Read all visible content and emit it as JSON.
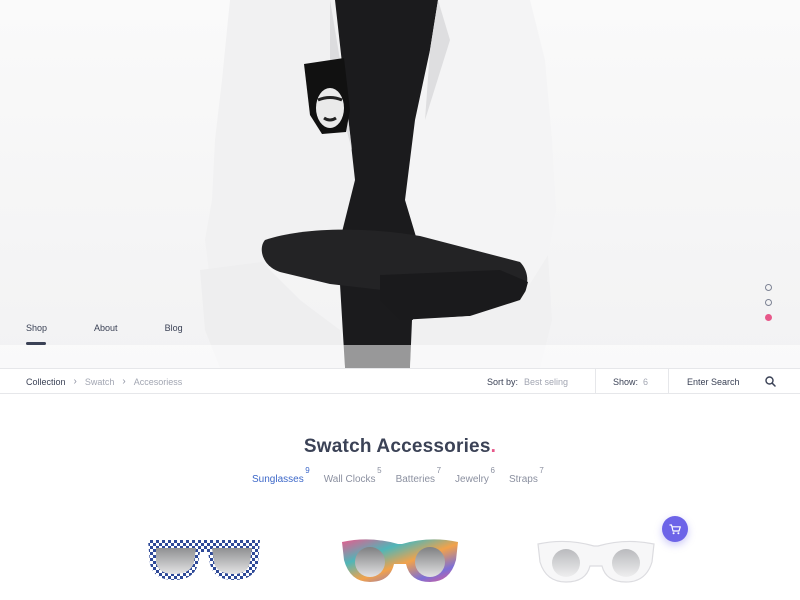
{
  "nav": {
    "items": [
      {
        "label": "Shop",
        "active": true
      },
      {
        "label": "About",
        "active": false
      },
      {
        "label": "Blog",
        "active": false
      }
    ]
  },
  "slider": {
    "slides": 3,
    "active_index": 2
  },
  "toolbar": {
    "breadcrumb": [
      "Collection",
      "Swatch",
      "Accesoriess"
    ],
    "sort_label": "Sort by:",
    "sort_value": "Best seling",
    "show_label": "Show:",
    "show_value": "6",
    "search_placeholder": "Enter Search"
  },
  "section": {
    "title": "Swatch Accessories",
    "title_accent": "."
  },
  "categories": [
    {
      "label": "Sunglasses",
      "count": "9",
      "active": true
    },
    {
      "label": "Wall Clocks",
      "count": "5",
      "active": false
    },
    {
      "label": "Batteries",
      "count": "7",
      "active": false
    },
    {
      "label": "Jewelry",
      "count": "6",
      "active": false
    },
    {
      "label": "Straps",
      "count": "7",
      "active": false
    }
  ],
  "products": [
    {
      "name": "checkered-blue-sunglasses"
    },
    {
      "name": "rainbow-round-sunglasses"
    },
    {
      "name": "clear-white-sunglasses"
    }
  ],
  "colors": {
    "accent_pink": "#e7588a",
    "accent_blue": "#3d68c9",
    "cart_purple": "#6d64e8",
    "text_dark": "#3b4256"
  },
  "icons": {
    "search": "search-icon",
    "cart": "cart-icon",
    "chevron": "chevron-right-icon"
  }
}
